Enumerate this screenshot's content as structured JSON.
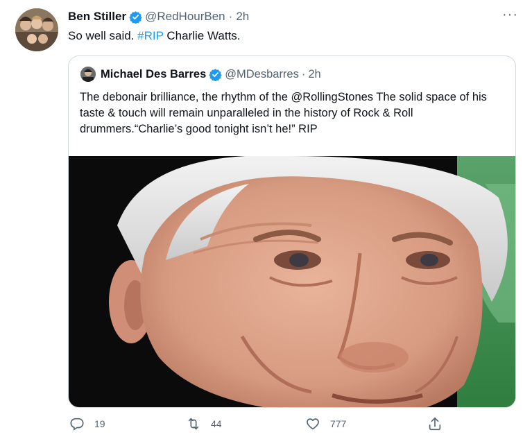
{
  "tweet": {
    "author_name": "Ben Stiller",
    "author_handle": "@RedHourBen",
    "time": "2h",
    "text_prefix": "So well said. ",
    "hashtag": "#RIP",
    "text_suffix": " Charlie Watts."
  },
  "quote": {
    "author_name": "Michael Des Barres",
    "author_handle": "@MDesbarres",
    "time": "2h",
    "text": "The debonair brilliance, the rhythm of the @RollingStones The solid space of his taste & touch will remain unparalleled in the history of Rock & Roll drummers.“Charlie’s good tonight isn’t he!” RIP"
  },
  "actions": {
    "replies": "19",
    "retweets": "44",
    "likes": "777"
  },
  "separator": "·",
  "more_glyph": "···",
  "icons": {
    "verified": "verified-badge-icon",
    "reply": "reply-icon",
    "retweet": "retweet-icon",
    "like": "heart-icon",
    "share": "share-icon",
    "more": "more-options-icon"
  },
  "colors": {
    "accent": "#1d9bf0",
    "text": "#0f1419",
    "secondary": "#536471",
    "border": "#cfd9de"
  }
}
